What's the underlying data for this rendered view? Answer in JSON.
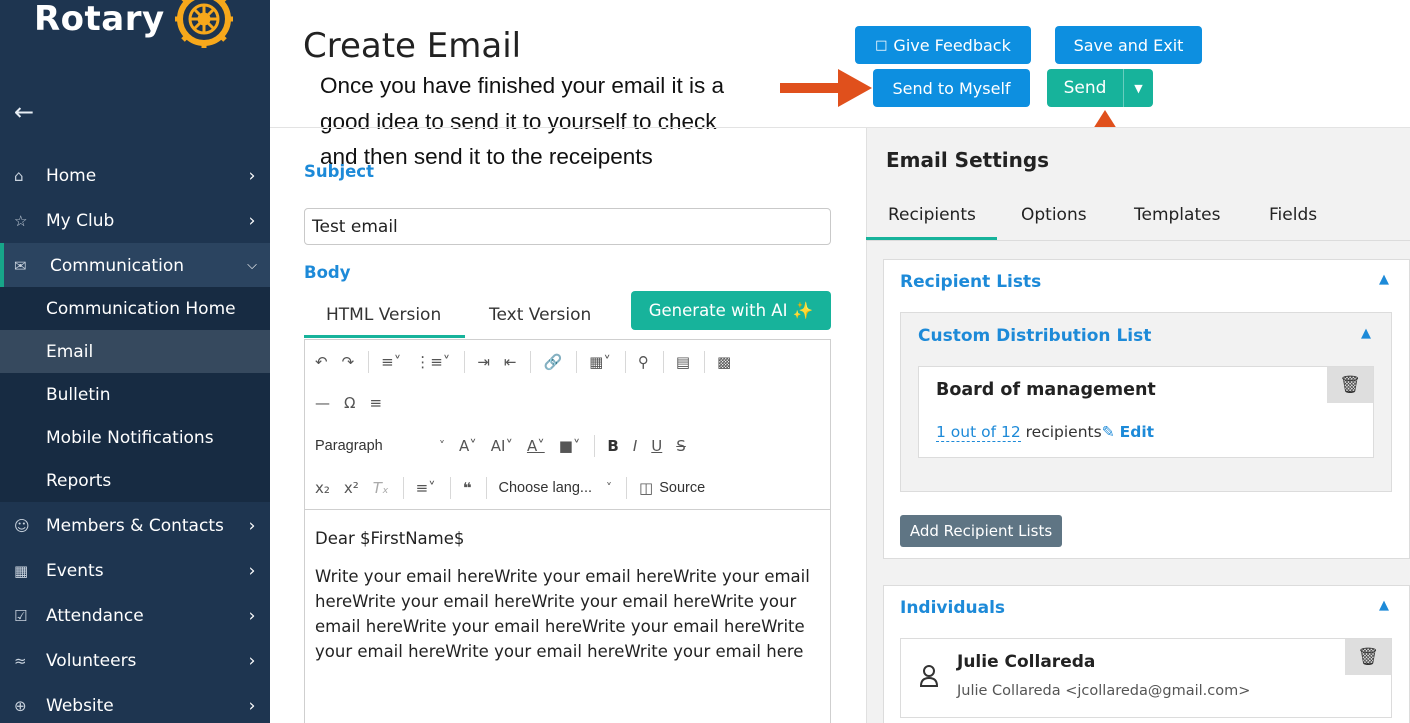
{
  "brand": {
    "name": "Rotary",
    "color": "#f7a81b"
  },
  "sidebar": {
    "back_icon": "arrow-left-icon",
    "items": [
      {
        "label": "Home",
        "icon": "home-icon"
      },
      {
        "label": "My Club",
        "icon": "star-icon"
      },
      {
        "label": "Communication",
        "icon": "mail-icon"
      },
      {
        "label": "Members & Contacts",
        "icon": "user-icon"
      },
      {
        "label": "Events",
        "icon": "calendar-icon"
      },
      {
        "label": "Attendance",
        "icon": "checkbox-icon"
      },
      {
        "label": "Volunteers",
        "icon": "volunteer-icon"
      },
      {
        "label": "Website",
        "icon": "globe-icon"
      }
    ],
    "subitems": [
      {
        "label": "Communication Home"
      },
      {
        "label": "Email"
      },
      {
        "label": "Bulletin"
      },
      {
        "label": "Mobile Notifications"
      },
      {
        "label": "Reports"
      }
    ]
  },
  "header": {
    "title": "Create Email",
    "give_feedback": "Give Feedback",
    "save_exit": "Save and Exit",
    "send_myself": "Send to Myself",
    "send": "Send"
  },
  "annotation": {
    "line1": "Once you have finished your email it is a",
    "line2": "good idea to send it to yourself to check",
    "line3": "and then send it to the receipents"
  },
  "form": {
    "subject_label": "Subject",
    "subject_value": "Test email",
    "body_label": "Body",
    "tab_html": "HTML Version",
    "tab_text": "Text Version",
    "ai_button": "Generate with AI ✨"
  },
  "toolbar": {
    "paragraph": "Paragraph",
    "language": "Choose lang...",
    "source": "Source"
  },
  "editor": {
    "greeting": "Dear $FirstName$",
    "body": "Write your email hereWrite your email hereWrite your email hereWrite your email hereWrite your email hereWrite your email hereWrite your email hereWrite your email hereWrite your email hereWrite your email hereWrite your email here"
  },
  "settings": {
    "title": "Email Settings",
    "tabs": [
      "Recipients",
      "Options",
      "Templates",
      "Fields"
    ],
    "recipient_lists": "Recipient Lists",
    "custom_list": "Custom Distribution List",
    "list_name": "Board of management",
    "recipients_count": "1 out of 12",
    "recipients_word": "recipients",
    "edit": "Edit",
    "add_lists": "Add Recipient Lists",
    "individuals": "Individuals",
    "person_name": "Julie Collareda",
    "person_email": "Julie Collareda <jcollareda@gmail.com>"
  },
  "colors": {
    "sidebar": "#1e3550",
    "accent_teal": "#17b39b",
    "accent_blue": "#0d8fe0",
    "arrow": "#e0501c"
  }
}
